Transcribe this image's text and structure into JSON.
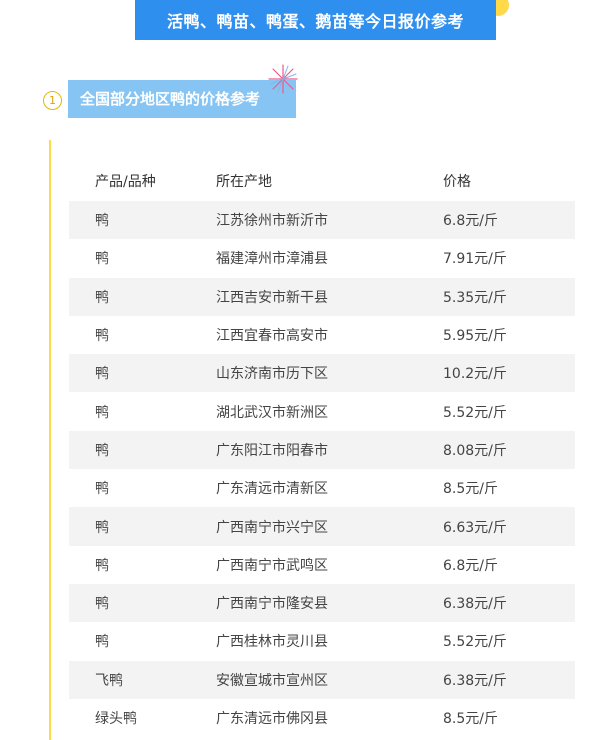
{
  "header": {
    "banner_title": "活鸭、鸭苗、鸭蛋、鹅苗等今日报价参考"
  },
  "section": {
    "number": "1",
    "title": "全国部分地区鸭的价格参考"
  },
  "colors": {
    "banner_blue": "#2f8fef",
    "section_blue": "#86c4f3",
    "accent_yellow": "#ffd84d",
    "row_shade": "#f3f3f3"
  },
  "table": {
    "headers": [
      "产品/品种",
      "所在产地",
      "价格"
    ],
    "rows": [
      [
        "鸭",
        "江苏徐州市新沂市",
        "6.8元/斤"
      ],
      [
        "鸭",
        "福建漳州市漳浦县",
        "7.91元/斤"
      ],
      [
        "鸭",
        "江西吉安市新干县",
        "5.35元/斤"
      ],
      [
        "鸭",
        "江西宜春市高安市",
        "5.95元/斤"
      ],
      [
        "鸭",
        "山东济南市历下区",
        "10.2元/斤"
      ],
      [
        "鸭",
        "湖北武汉市新洲区",
        "5.52元/斤"
      ],
      [
        "鸭",
        "广东阳江市阳春市",
        "8.08元/斤"
      ],
      [
        "鸭",
        "广东清远市清新区",
        "8.5元/斤"
      ],
      [
        "鸭",
        "广西南宁市兴宁区",
        "6.63元/斤"
      ],
      [
        "鸭",
        "广西南宁市武鸣区",
        "6.8元/斤"
      ],
      [
        "鸭",
        "广西南宁市隆安县",
        "6.38元/斤"
      ],
      [
        "鸭",
        "广西桂林市灵川县",
        "5.52元/斤"
      ],
      [
        "飞鸭",
        "安徽宣城市宣州区",
        "6.38元/斤"
      ],
      [
        "绿头鸭",
        "广东清远市佛冈县",
        "8.5元/斤"
      ]
    ]
  }
}
